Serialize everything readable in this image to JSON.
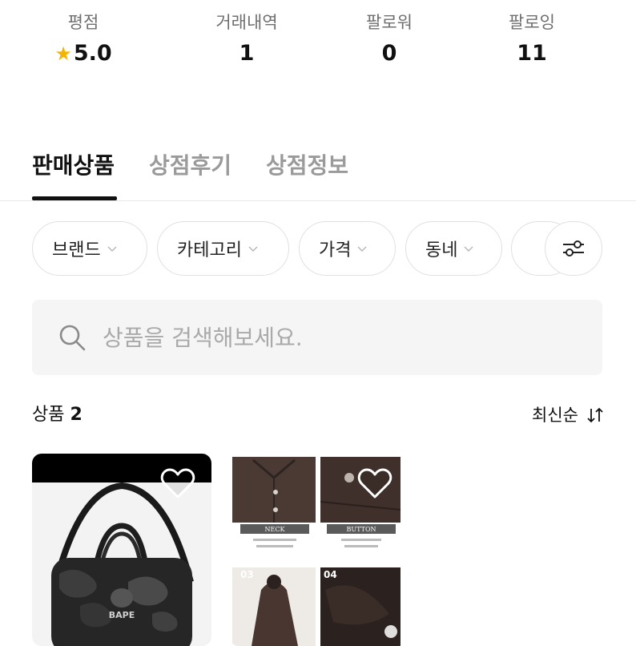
{
  "stats": [
    {
      "label": "평점",
      "value": "5.0",
      "icon": "star-icon"
    },
    {
      "label": "거래내역",
      "value": "1"
    },
    {
      "label": "팔로워",
      "value": "0"
    },
    {
      "label": "팔로잉",
      "value": "11"
    }
  ],
  "tabs": [
    {
      "label": "판매상품",
      "active": true
    },
    {
      "label": "상점후기",
      "active": false
    },
    {
      "label": "상점정보",
      "active": false
    }
  ],
  "filters": [
    {
      "label": "브랜드"
    },
    {
      "label": "카테고리"
    },
    {
      "label": "가격"
    },
    {
      "label": "동네"
    }
  ],
  "search": {
    "placeholder": "상품을 검색해보세요."
  },
  "list": {
    "count_label": "상품",
    "count": "2",
    "sort_label": "최신순"
  },
  "products": [
    {
      "name": "BAPE 더플 백",
      "image_text": "BAPE",
      "liked": false
    },
    {
      "name": "브라운 셔츠",
      "image_labels": [
        "NECK",
        "BUTTON",
        "03",
        "04"
      ],
      "liked": false
    }
  ],
  "colors": {
    "star": "#f5b301",
    "active_tab": "#111111",
    "inactive_tab": "#9a9a9a"
  }
}
